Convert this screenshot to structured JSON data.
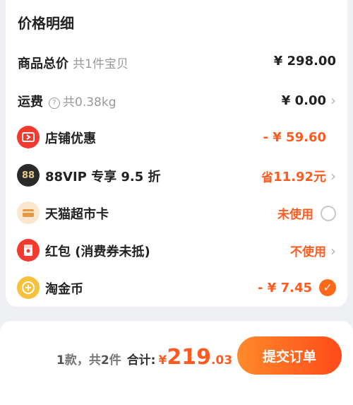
{
  "price_detail": {
    "title": "价格明细",
    "total_goods": {
      "label": "商品总价",
      "sub": "共1件宝贝",
      "value": "¥ 298.00"
    },
    "shipping": {
      "label": "运费",
      "help": "?",
      "sub": "共0.38kg",
      "value": "¥ 0.00"
    },
    "store_discount": {
      "label": "店铺优惠",
      "value": "- ¥ 59.60"
    },
    "vip": {
      "label": "88VIP 专享 9.5 折",
      "badge": "88",
      "value_prefix": "省",
      "value": "11.92元"
    },
    "tmall_card": {
      "label": "天猫超市卡",
      "value": "未使用"
    },
    "red_packet": {
      "label": "红包 (消费券未抵)",
      "value": "不使用"
    },
    "coins": {
      "label": "淘金币",
      "value": "- ¥ 7.45"
    }
  },
  "footer": {
    "count_a": "1",
    "count_a_unit": "款，共",
    "count_b": "2",
    "count_b_unit": "件",
    "total_label": "合计:",
    "currency": "¥",
    "total_int": "219",
    "total_dec": ".03",
    "submit_label": "提交订单"
  },
  "colors": {
    "accent": "#ff5a1f",
    "vip_bg": "#2a2a2a",
    "red": "#f23a2e",
    "gold": "#f6c23e"
  }
}
